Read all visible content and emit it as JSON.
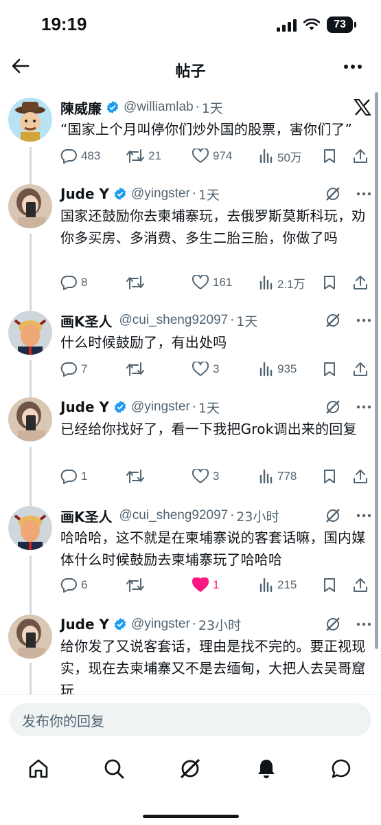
{
  "status_bar": {
    "time": "19:19",
    "battery": "73"
  },
  "header": {
    "title": "帖子"
  },
  "posts": [
    {
      "name": "陳威廉",
      "handle": "@williamlab",
      "time": "1天",
      "text": "“国家上个月叫停你们炒外国的股票，害你们了”",
      "replies": "483",
      "reposts": "21",
      "likes": "974",
      "views": "50万",
      "liked": false
    },
    {
      "name": "Jude Y",
      "handle": "@yingster",
      "time": "1天",
      "text": "国家还鼓励你去柬埔寨玩，去俄罗斯莫斯科玩，劝你多买房、多消费、多生二胎三胎，你做了吗",
      "replies": "8",
      "reposts": "",
      "likes": "161",
      "views": "2.1万",
      "liked": false
    },
    {
      "name": "画K圣人",
      "handle": "@cui_sheng92097",
      "time": "1天",
      "text": "什么时候鼓励了，有出处吗",
      "replies": "7",
      "reposts": "",
      "likes": "3",
      "views": "935",
      "liked": false
    },
    {
      "name": "Jude Y",
      "handle": "@yingster",
      "time": "1天",
      "text": "已经给你找好了，看一下我把Grok调出来的回复",
      "replies": "1",
      "reposts": "",
      "likes": "3",
      "views": "778",
      "liked": false
    },
    {
      "name": "画K圣人",
      "handle": "@cui_sheng92097",
      "time": "23小时",
      "text": "哈哈哈，这不就是在柬埔寨说的客套话嘛，国内媒体什么时候鼓励去柬埔寨玩了哈哈哈",
      "replies": "6",
      "reposts": "",
      "likes": "1",
      "views": "215",
      "liked": true
    },
    {
      "name": "Jude Y",
      "handle": "@yingster",
      "time": "23小时",
      "text": "给你发了又说客套话，理由是找不完的。要正视现实，现在去柬埔寨又不是去缅甸，大把人去吴哥窟玩",
      "replies": "",
      "reposts": "",
      "likes": "",
      "views": "",
      "liked": false
    }
  ],
  "reply_bar": {
    "placeholder": "发布你的回复"
  },
  "colors": {
    "accent": "#1d9bf0",
    "like": "#f91880",
    "muted": "#536471"
  }
}
